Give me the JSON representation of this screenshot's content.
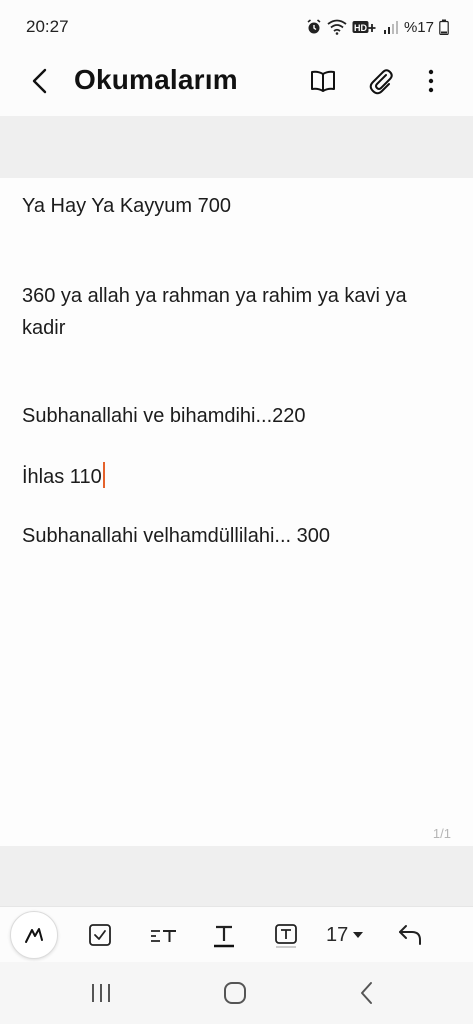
{
  "status_bar": {
    "time": "20:27",
    "battery_text": "%17",
    "icons": [
      "alarm-icon",
      "wifi-icon",
      "hd-plus-icon",
      "signal-icon",
      "battery-icon"
    ]
  },
  "header": {
    "title": "Okumalarım",
    "actions": [
      "book-icon",
      "paperclip-icon",
      "more-vertical-icon"
    ]
  },
  "note": {
    "lines": [
      "Ya Hay Ya Kayyum 700",
      "360 ya allah ya rahman ya rahim ya kavi ya kadir",
      "Subhanallahi ve bihamdihi...220",
      "İhlas 110",
      "Subhanallahi velhamdüllilahi... 300"
    ],
    "page_indicator": "1/1",
    "caret_color": "#e5622c"
  },
  "toolbar": {
    "font_size": "17",
    "tools": [
      "pen-icon",
      "checkbox-icon",
      "text-style-icon",
      "underline-text-icon",
      "text-box-icon",
      "font-size-dropdown",
      "undo-icon"
    ]
  },
  "nav": {
    "buttons": [
      "recent-apps-icon",
      "home-icon",
      "back-icon"
    ]
  }
}
